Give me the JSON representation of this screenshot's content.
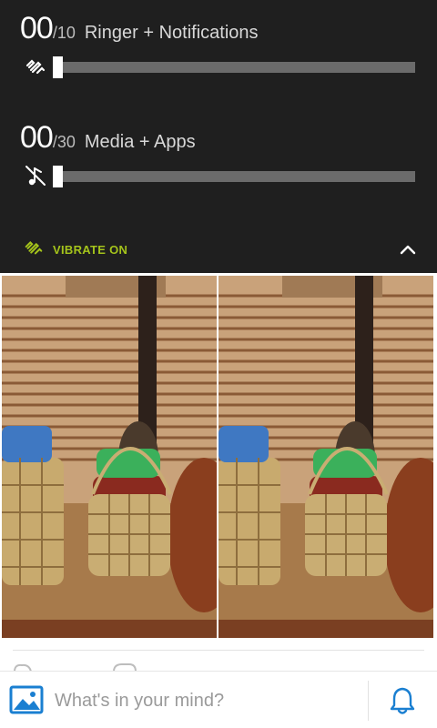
{
  "volume": {
    "ringer": {
      "value": "00",
      "max": "/10",
      "label": "Ringer + Notifications",
      "level": 0,
      "icon": "vibrate-icon"
    },
    "media": {
      "value": "00",
      "max": "/30",
      "label": "Media + Apps",
      "level": 0,
      "icon": "music-muted-icon"
    },
    "vibrate_label": "VIBRATE ON",
    "vibrate_icon": "vibrate-icon",
    "collapse_icon": "chevron-up-icon"
  },
  "photos": [
    {
      "alt": "wicker baskets with jars"
    },
    {
      "alt": "wicker baskets with jars"
    }
  ],
  "composer": {
    "placeholder": "What's in your mind?",
    "photo_icon": "image-icon",
    "notification_icon": "bell-icon"
  },
  "colors": {
    "panel_bg": "#1f1f1f",
    "accent": "#a4c31b",
    "link_blue": "#1a7fd1",
    "track": "#6b6b6b"
  }
}
